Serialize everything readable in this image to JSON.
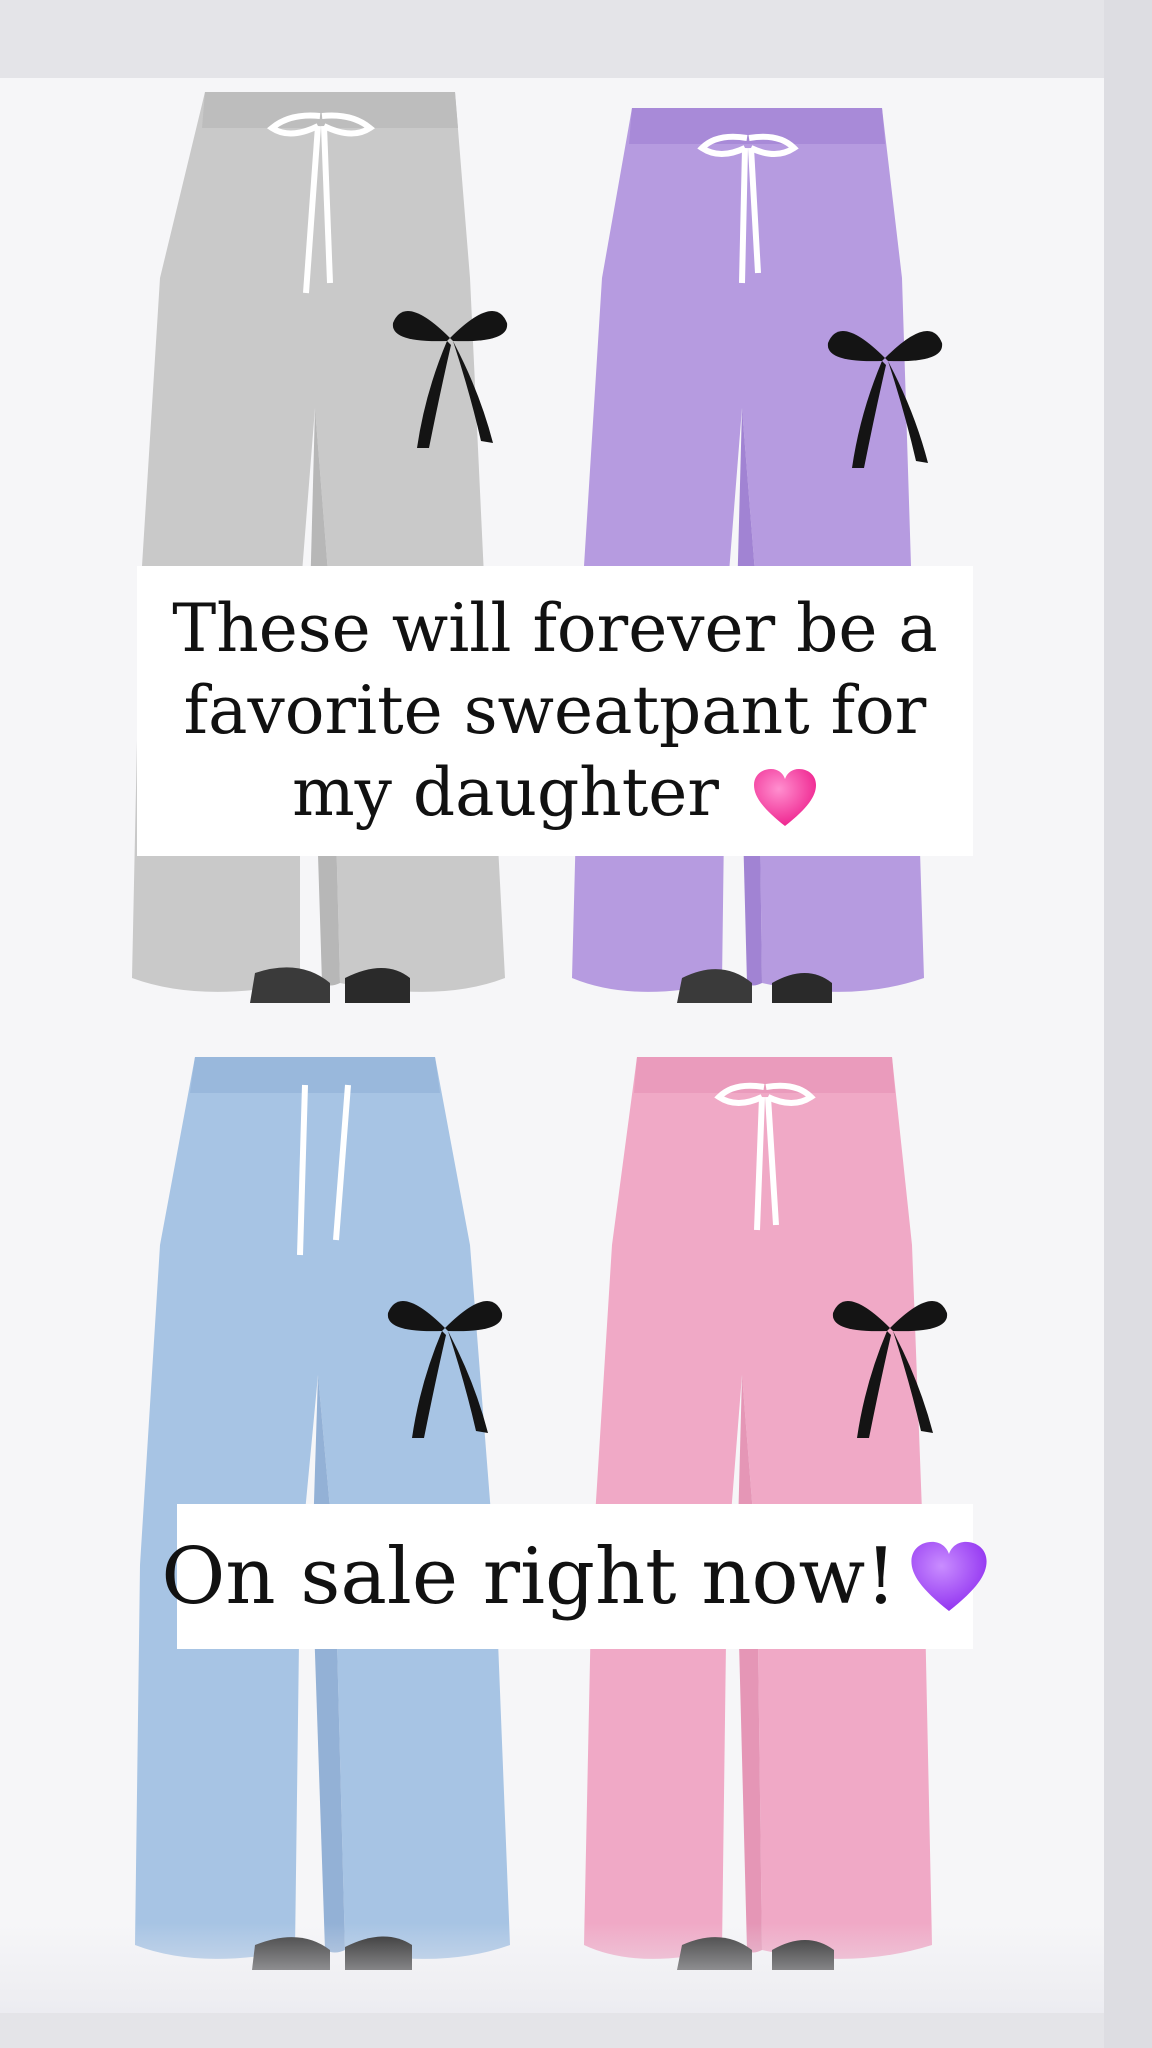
{
  "story": {
    "captions": {
      "top": "These will forever be a favorite sweatpant for my daughter",
      "bottom": "On sale right now!"
    },
    "emoji": {
      "top": "pink-heart-icon",
      "bottom": "purple-heart-icon"
    },
    "colors": {
      "grey_pants": "#c9c9c9",
      "purple_pants": "#b69be0",
      "blue_pants": "#a7c4e4",
      "pink_pants": "#f0a9c6",
      "bow": "#141414",
      "pink_heart": "#ff3fa4",
      "purple_heart": "#a64df5"
    },
    "products": [
      {
        "color_name": "grey"
      },
      {
        "color_name": "purple"
      },
      {
        "color_name": "blue"
      },
      {
        "color_name": "pink"
      }
    ]
  }
}
